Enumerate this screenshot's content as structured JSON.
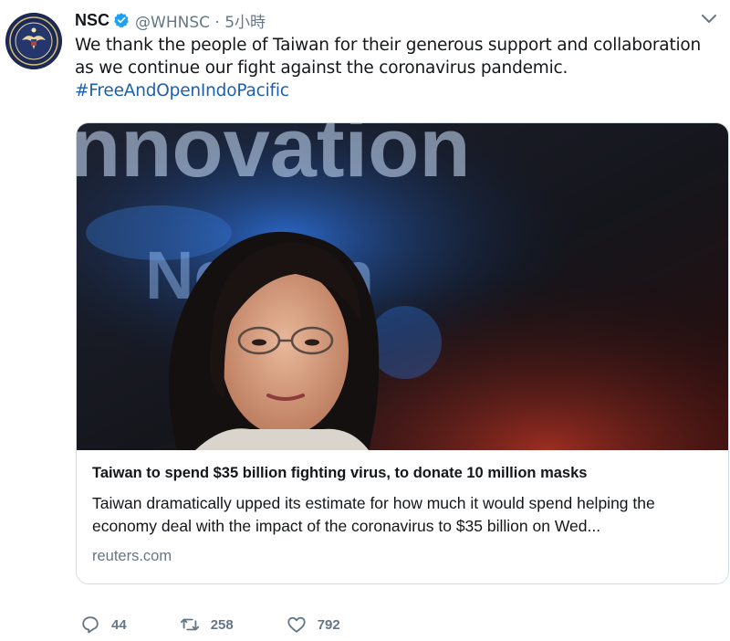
{
  "tweet": {
    "author_name": "NSC",
    "handle_time": "@WHNSC · 5小時",
    "text": "We thank the people of Taiwan for their generous support and collaboration as we continue our fight against the coronavirus pandemic.",
    "hashtag": "#FreeAndOpenIndoPacific"
  },
  "card": {
    "title": "Taiwan to spend $35 billion fighting virus, to donate 10 million masks",
    "description": "Taiwan dramatically upped its estimate for how much it would spend helping the economy deal with the impact of the coronavirus to $35 billion on Wed...",
    "domain": "reuters.com",
    "image_text_top": "nnovation",
    "image_text_mid": "Nevern"
  },
  "actions": {
    "reply_count": "44",
    "retweet_count": "258",
    "like_count": "792"
  },
  "icons": {
    "avatar": "presidential-seal-icon",
    "verified": "verified-badge-icon",
    "caret": "chevron-down-icon",
    "reply": "reply-icon",
    "retweet": "retweet-icon",
    "like": "heart-icon"
  },
  "colors": {
    "accent": "#1da1f2",
    "hashtag": "#1b5fae",
    "muted": "#657786"
  }
}
